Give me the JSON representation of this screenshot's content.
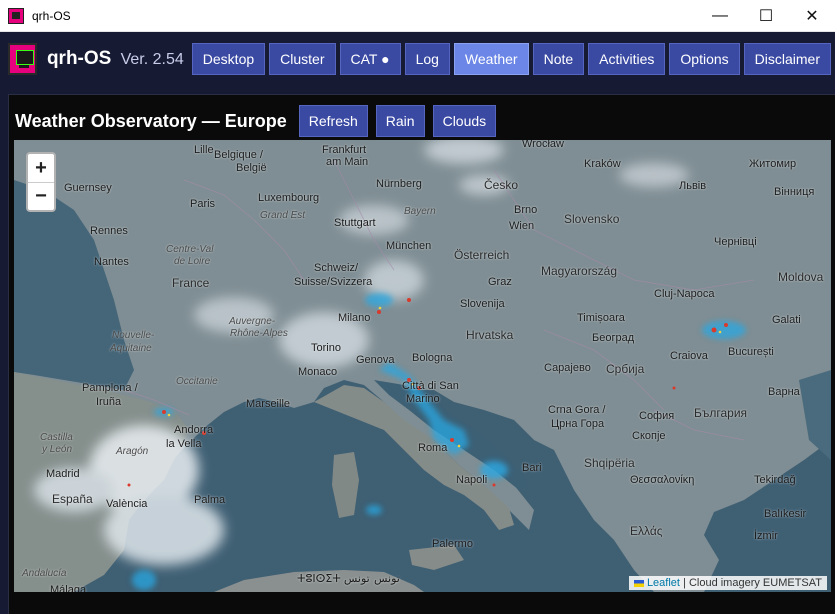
{
  "window": {
    "title": "qrh-OS",
    "controls": {
      "minimize": "—",
      "maximize": "☐",
      "close": "✕"
    }
  },
  "app": {
    "name": "qrh-OS",
    "version": "Ver. 2.54",
    "nav": [
      {
        "label": "Desktop",
        "active": false
      },
      {
        "label": "Cluster",
        "active": false
      },
      {
        "label": "CAT ●",
        "active": false
      },
      {
        "label": "Log",
        "active": false
      },
      {
        "label": "Weather",
        "active": true
      },
      {
        "label": "Note",
        "active": false
      },
      {
        "label": "Activities",
        "active": false
      },
      {
        "label": "Options",
        "active": false
      },
      {
        "label": "Disclaimer",
        "active": false
      }
    ]
  },
  "panel": {
    "title": "Weather Observatory — Europe",
    "buttons": {
      "refresh": "Refresh",
      "rain": "Rain",
      "clouds": "Clouds"
    }
  },
  "map": {
    "zoom_in": "+",
    "zoom_out": "−",
    "attribution": {
      "link": "Leaflet",
      "rest": "| Cloud imagery EUMETSAT"
    },
    "labels": {
      "lille": "Lille",
      "belgique": "Belgique /",
      "belgie": "België",
      "frankfurt": "Frankfurt",
      "ammain": "am Main",
      "wroclaw": "Wrocław",
      "krakow": "Kraków",
      "zhytomyr": "Житомир",
      "guernsey": "Guernsey",
      "paris": "Paris",
      "luxembourg": "Luxembourg",
      "grandest": "Grand Est",
      "nurnberg": "Nürnberg",
      "bayern": "Bayern",
      "cesko": "Česko",
      "lviv": "Львів",
      "vinnytsia": "Вінниця",
      "rennes": "Rennes",
      "stuttgart": "Stuttgart",
      "brno": "Brno",
      "slovensko": "Slovensko",
      "wien": "Wien",
      "chernivtsi": "Чернівці",
      "centreval": "Centre-Val",
      "deloire": "de Loire",
      "nantes": "Nantes",
      "munchen": "München",
      "osterreich": "Österreich",
      "moldova": "Moldova",
      "france": "France",
      "schweiz": "Schweiz/",
      "suisse": "Suisse/Svizzera",
      "graz": "Graz",
      "magyarorszag": "Magyarország",
      "auvergne": "Auvergne-",
      "rhonealpes": "Rhône-Alpes",
      "slovenija": "Slovenija",
      "milano": "Milano",
      "timisoara": "Timișoara",
      "clujnapoca": "Cluj-Napoca",
      "galati": "Galati",
      "nouvelle": "Nouvelle-",
      "aquitaine": "Aquitaine",
      "beograd": "Београд",
      "torino": "Torino",
      "hrvatska": "Hrvatska",
      "bucuresti": "București",
      "craiova": "Craiova",
      "monaco": "Monaco",
      "genova": "Genova",
      "bologna": "Bologna",
      "sarajevo": "Сарајево",
      "srbija": "Србија",
      "occitanie": "Occitanie",
      "pamplona": "Pamplona /",
      "iruna": "Iruña",
      "marseille": "Marseille",
      "sanmarino1": "Città di San",
      "sanmarino2": "Marino",
      "varna": "Варна",
      "andorra1": "Andorra",
      "andorra2": "la Vella",
      "crnagora1": "Crna Gora /",
      "crnagora2": "Црна Гора",
      "sofia": "София",
      "bulgaria": "България",
      "castilla1": "Castilla",
      "castilla2": "y León",
      "aragon": "Aragón",
      "roma": "Roma",
      "skopje": "Скопје",
      "madrid": "Madrid",
      "bari": "Bari",
      "shqiperia": "Shqipëria",
      "espana": "España",
      "napoli": "Napoli",
      "thessaloniki": "Θεσσαλονίκη",
      "valencia": "València",
      "palma": "Palma",
      "tekirdag": "Tekirdağ",
      "balikesir": "Balıkesir",
      "izmir": "İzmir",
      "ellada": "Ελλάς",
      "palermo": "Palermo",
      "andalucia": "Andalucía",
      "malaga": "Málaga",
      "tunis": "تونس",
      "tunisia": "ⵜⵓⵏⵙⵉⵜ تونس"
    }
  }
}
